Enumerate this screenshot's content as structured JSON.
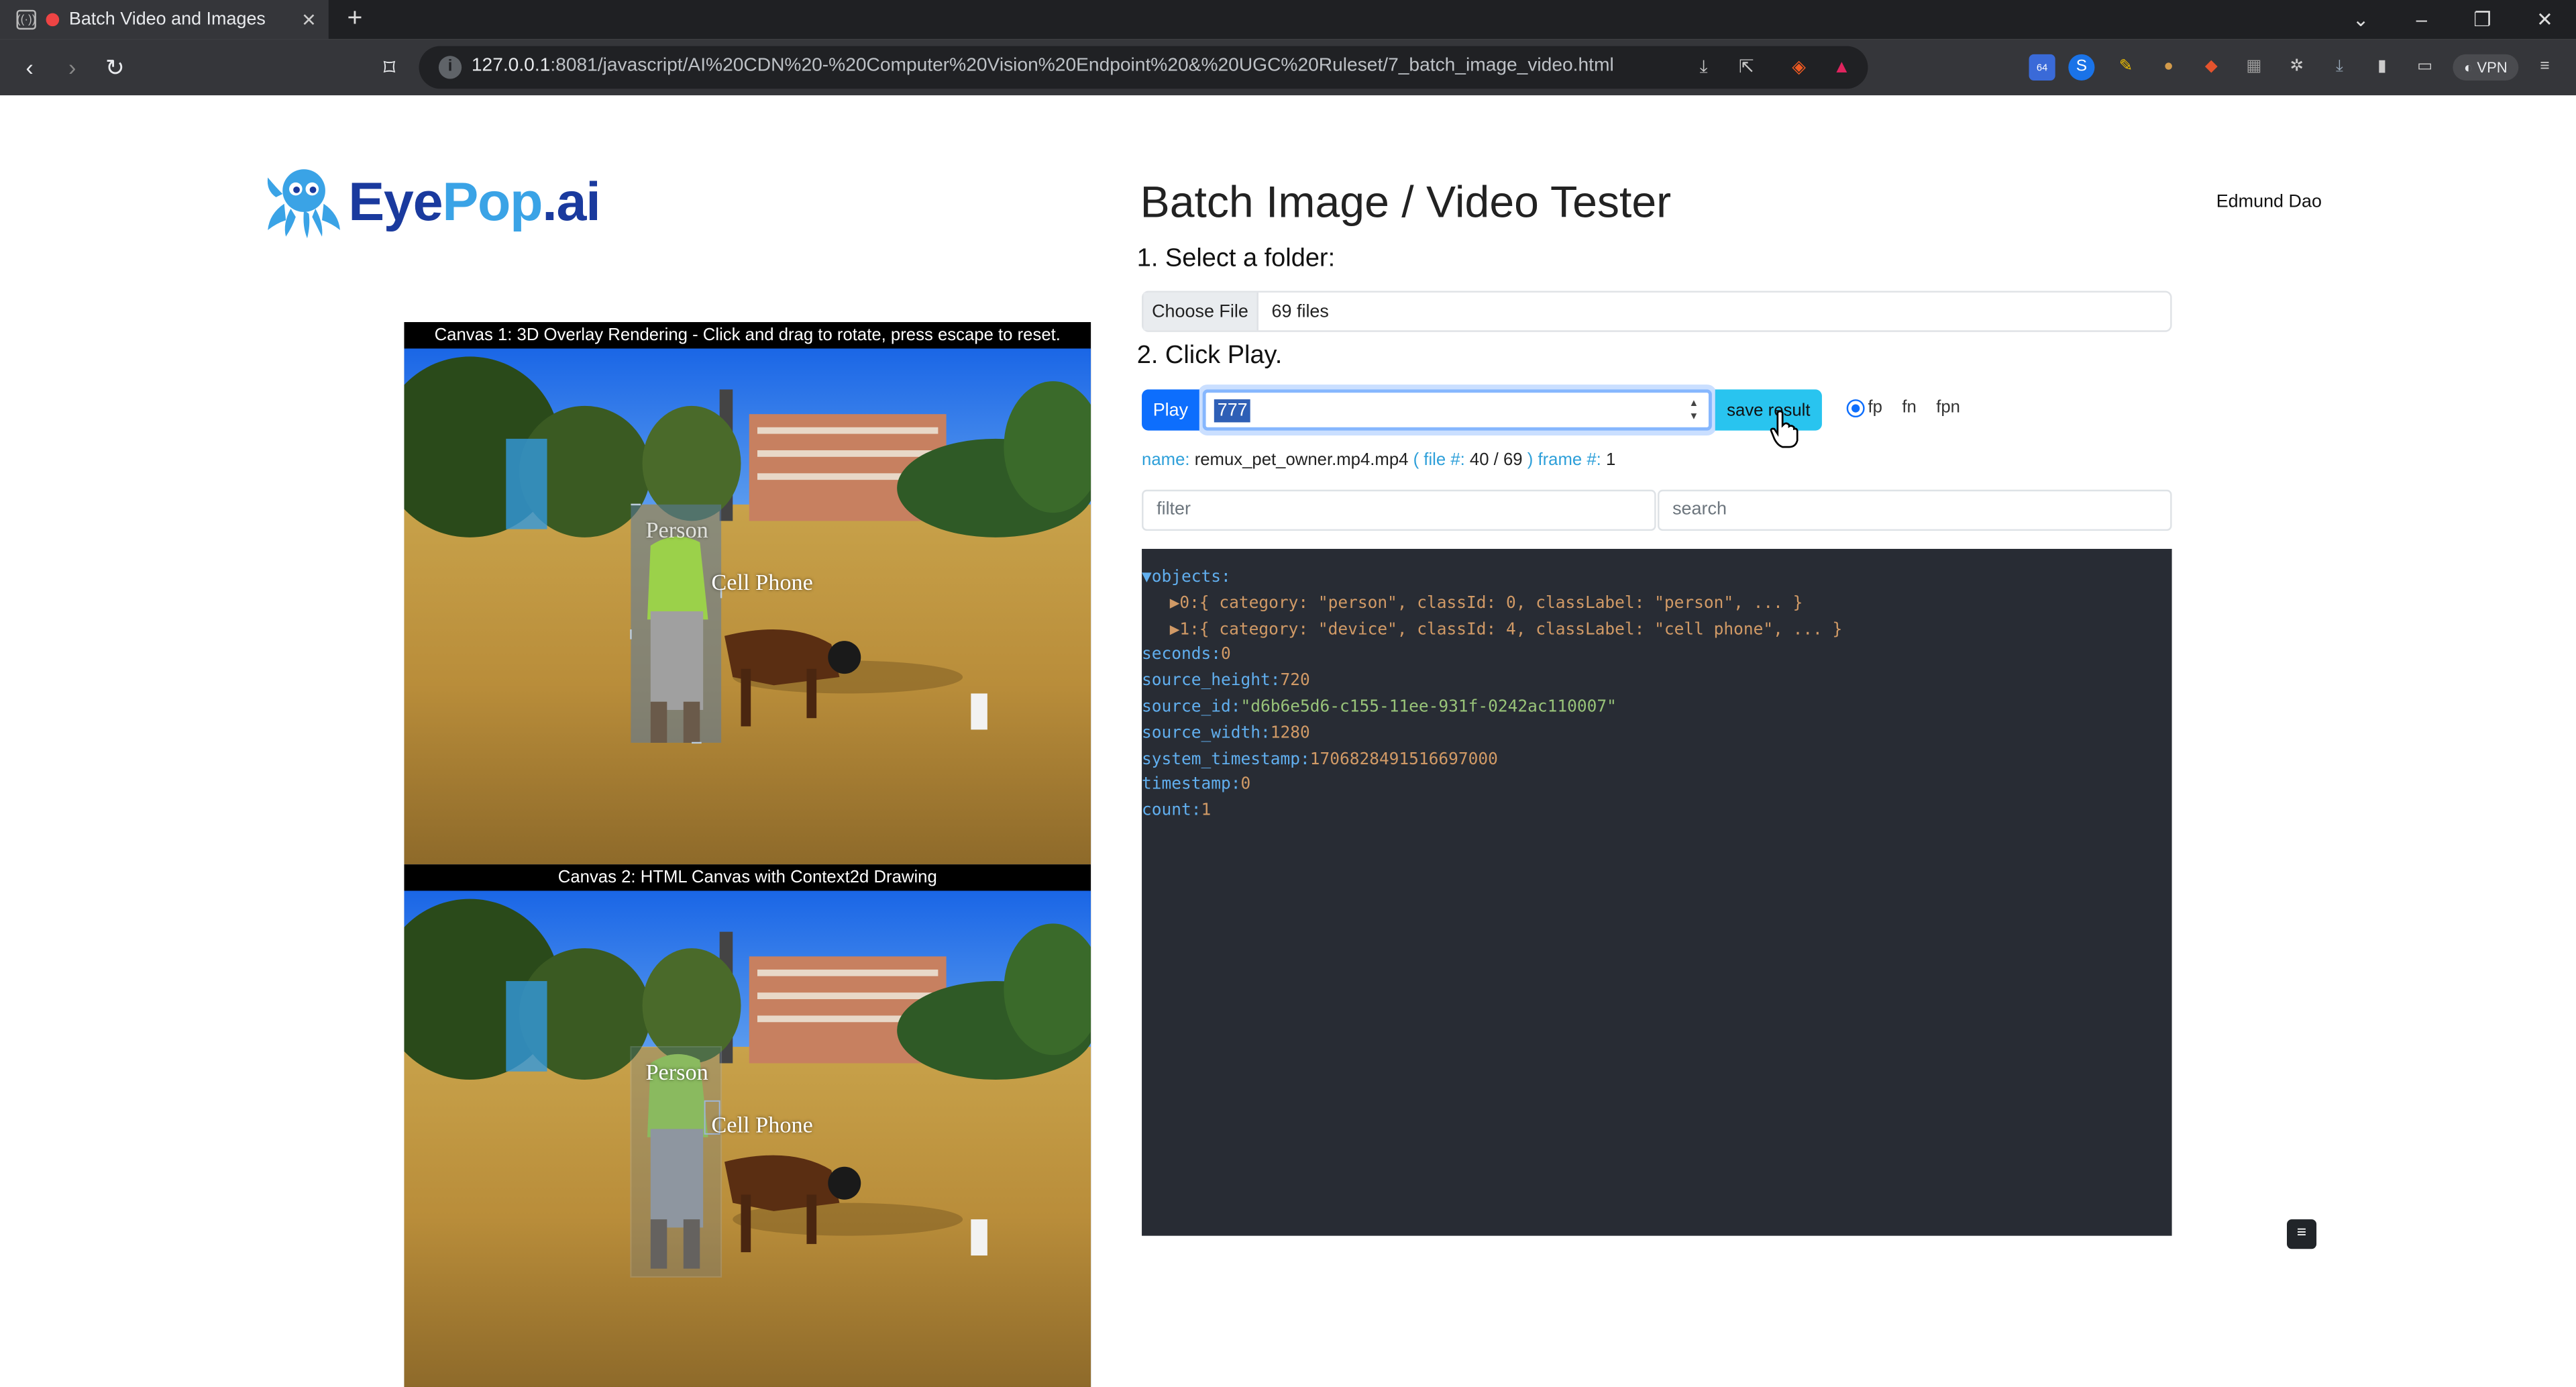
{
  "browser": {
    "tab_title": "Batch Video and Images",
    "tab_close": "✕",
    "new_tab": "+",
    "url_host": "127.0.0.1",
    "url_path": ":8081/javascript/AI%20CDN%20-%20Computer%20Vision%20Endpoint%20&%20UGC%20Ruleset/7_batch_image_video.html",
    "vpn_label": "VPN",
    "ext_badge": "64"
  },
  "logo": {
    "eye": "Eye",
    "pop": "Pop",
    "ai": ".ai"
  },
  "header": {
    "title": "Batch Image / Video Tester",
    "user": "Edmund Dao"
  },
  "steps": {
    "step1": "1. Select a folder:",
    "step2": "2. Click Play."
  },
  "folder": {
    "choose_label": "Choose File",
    "value": "69 files"
  },
  "controls": {
    "play_label": "Play",
    "frame_value": "777",
    "save_label": "save result",
    "radios": [
      {
        "label": "fp",
        "checked": true
      },
      {
        "label": "fn",
        "checked": false
      },
      {
        "label": "fpn",
        "checked": false
      }
    ]
  },
  "meta": {
    "name_key": "name:",
    "name_val": "remux_pet_owner.mp4.mp4",
    "file_key": "( file #:",
    "file_val": "40 / 69",
    "frame_key": ") frame #:",
    "frame_val": "1"
  },
  "filters": {
    "filter_placeholder": "filter",
    "search_placeholder": "search"
  },
  "json_view": {
    "objects_key": "▼objects:",
    "obj0": "▶0:{ category: \"person\", classId: 0, classLabel: \"person\", ... }",
    "obj1": "▶1:{ category: \"device\", classId: 4, classLabel: \"cell phone\", ... }",
    "seconds_key": "seconds:",
    "seconds_val": "0",
    "source_height_key": "source_height:",
    "source_height_val": "720",
    "source_id_key": "source_id:",
    "source_id_val": "\"d6b6e5d6-c155-11ee-931f-0242ac110007\"",
    "source_width_key": "source_width:",
    "source_width_val": "1280",
    "system_timestamp_key": "system_timestamp:",
    "system_timestamp_val": "1706828491516697000",
    "timestamp_key": "timestamp:",
    "timestamp_val": "0",
    "count_key": "count:",
    "count_val": "1"
  },
  "canvas1": {
    "caption": "Canvas 1: 3D Overlay Rendering - Click and drag to rotate, press escape to reset.",
    "label_person": "Person",
    "label_phone": "Cell Phone"
  },
  "canvas2": {
    "caption": "Canvas 2: HTML Canvas with Context2d Drawing",
    "label_person": "Person",
    "label_phone": "Cell Phone"
  },
  "menu_button": "≡",
  "colors": {
    "primary": "#0d6efd",
    "save": "#29c4ef",
    "json_bg": "#282c34"
  }
}
